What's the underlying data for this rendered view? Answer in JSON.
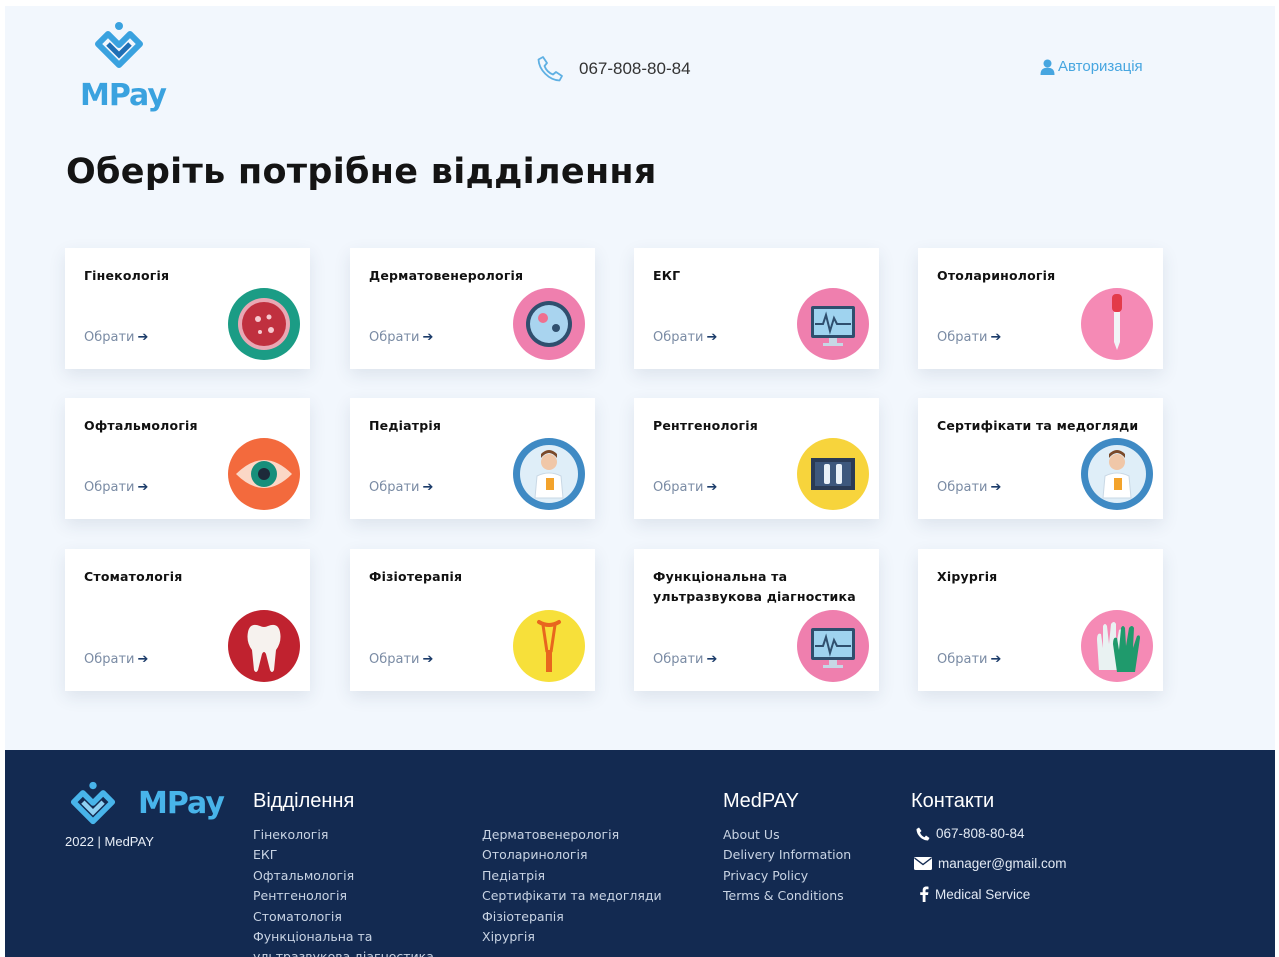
{
  "header": {
    "logo_text": "MPay",
    "phone": "067-808-80-84",
    "auth_label": "Авторизація"
  },
  "page_title": "Оберіть потрібне відділення",
  "card_link_label": "Обрати",
  "departments": [
    {
      "name": "Гінекологія",
      "icon": "cell-icon"
    },
    {
      "name": "Дерматовенерологія",
      "icon": "petri-dish-icon"
    },
    {
      "name": "ЕКГ",
      "icon": "ecg-monitor-icon"
    },
    {
      "name": "Отоларинологія",
      "icon": "dropper-icon"
    },
    {
      "name": "Офтальмологія",
      "icon": "eye-icon"
    },
    {
      "name": "Педіатрія",
      "icon": "doctor-icon"
    },
    {
      "name": "Рентгенологія",
      "icon": "xray-icon"
    },
    {
      "name": "Сертифікати та медогляди",
      "icon": "doctor-icon"
    },
    {
      "name": "Стоматологія",
      "icon": "tooth-icon"
    },
    {
      "name": "Фізіотерапія",
      "icon": "crutch-icon"
    },
    {
      "name": "Функціональна та ультразвукова діагностика",
      "icon": "ecg-monitor-icon"
    },
    {
      "name": "Хірургія",
      "icon": "gloves-icon"
    }
  ],
  "footer": {
    "logo_text": "MPay",
    "copyright": "2022 | MedPAY",
    "departments_heading": "Відділення",
    "departments_col1": [
      "Гінекологія",
      "ЕКГ",
      "Офтальмологія",
      "Рентгенологія",
      "Стоматологія",
      "Функціональна та",
      "ультразвукова діагностика"
    ],
    "departments_col2": [
      "Дерматовенерологія",
      "Отоларинологія",
      "Педіатрія",
      "Сертифікати та медогляди",
      "Фізіотерапія",
      "Хірургія"
    ],
    "medpay_heading": "MedPAY",
    "medpay_links": [
      "About Us",
      "Delivery Information",
      "Privacy Policy",
      "Terms & Conditions"
    ],
    "contacts_heading": "Контакти",
    "contact_phone": "067-808-80-84",
    "contact_email": "manager@gmail.com",
    "contact_facebook": "Medical Service"
  },
  "colors": {
    "page_bg": "#f2f7fd",
    "brand_blue": "#3aa2df",
    "footer_bg": "#132a51",
    "link_muted": "#7a8ba4"
  }
}
